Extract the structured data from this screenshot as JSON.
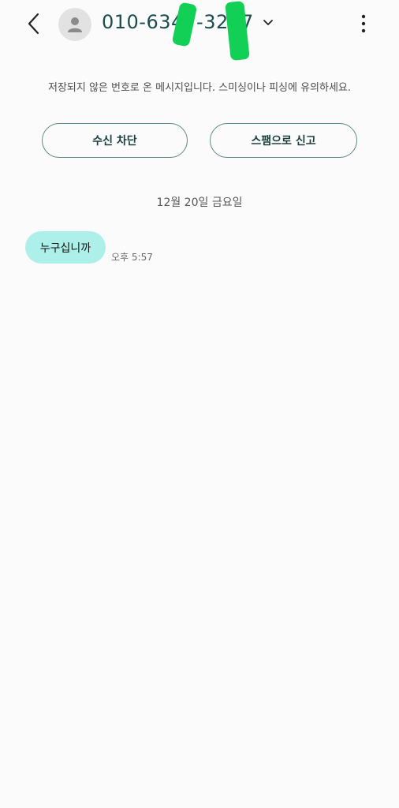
{
  "header": {
    "phone_number": "010-634  -32  7",
    "back_icon": "chevron-left-icon",
    "avatar_icon": "person-icon",
    "dropdown_icon": "chevron-down-icon",
    "more_icon": "more-vertical-icon"
  },
  "notice": {
    "text": "저장되지 않은 번호로 온 메시지입니다. 스미싱이나 피싱에 유의하세요."
  },
  "actions": {
    "block_label": "수신 차단",
    "report_label": "스팸으로 신고"
  },
  "conversation": {
    "date_label": "12월 20일 금요일",
    "messages": [
      {
        "text": "누구십니까",
        "time": "오후 5:57"
      }
    ]
  },
  "colors": {
    "background": "#fbfbfb",
    "accent": "#1c4d4e",
    "bubble": "#acf0e9",
    "redaction": "#12cf56"
  }
}
